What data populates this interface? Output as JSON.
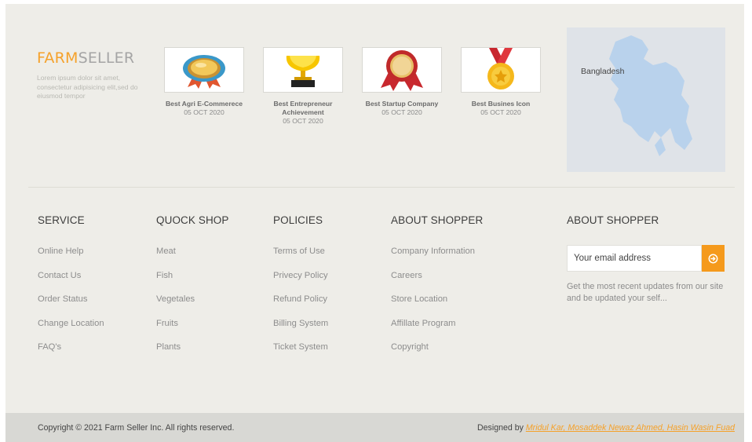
{
  "brand": {
    "accent": "FARM",
    "rest": "SELLER",
    "description": "Lorem ipsum dolor sit amet, consectetur adipisicing elit,sed do eiusmod tempor"
  },
  "awards": [
    {
      "icon": "rosette-badge-icon",
      "title": "Best Agri E-Commerece",
      "date": "05 OCT 2020"
    },
    {
      "icon": "trophy-icon",
      "title": "Best Entrepreneur Achievement",
      "date": "05 OCT 2020"
    },
    {
      "icon": "ribbon-award-icon",
      "title": "Best Startup Company",
      "date": "05 OCT 2020"
    },
    {
      "icon": "medal-icon",
      "title": "Best Busines Icon",
      "date": "05 OCT 2020"
    }
  ],
  "map": {
    "label": "Bangladesh"
  },
  "columns": [
    {
      "title": "SERVICE",
      "items": [
        "Online Help",
        "Contact Us",
        "Order Status",
        "Change Location",
        "FAQ's"
      ]
    },
    {
      "title": "QUOCK SHOP",
      "items": [
        "Meat",
        "Fish",
        "Vegetales",
        "Fruits",
        "Plants"
      ]
    },
    {
      "title": "POLICIES",
      "items": [
        "Terms of Use",
        "Privecy Policy",
        "Refund Policy",
        "Billing System",
        "Ticket System"
      ]
    },
    {
      "title": "ABOUT SHOPPER",
      "items": [
        "Company Information",
        "Careers",
        "Store Location",
        "Affillate Program",
        "Copyright"
      ]
    }
  ],
  "newsletter": {
    "title": "ABOUT SHOPPER",
    "placeholder": "Your email address",
    "description": "Get the most recent updates from our site and be updated your self..."
  },
  "bottom": {
    "copyright": "Copyright © 2021 Farm Seller Inc. All rights reserved.",
    "designed_prefix": "Designed by ",
    "designers": "Mridul Kar, Mosaddek Newaz Ahmed, Hasin Wasin Fuad"
  },
  "colors": {
    "accent": "#f5a12a",
    "footer_bg": "#eeede8",
    "bottom_bg": "#d8d8d4",
    "button": "#f59a1c"
  }
}
